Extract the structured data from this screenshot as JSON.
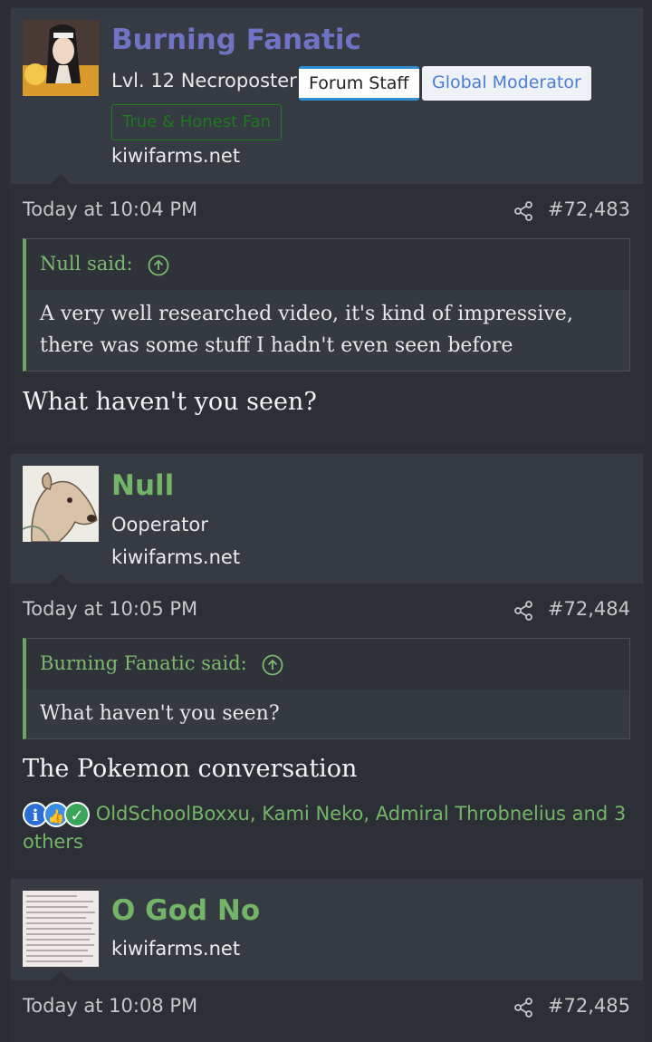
{
  "posts": [
    {
      "username": "Burning Fanatic",
      "username_color": "#7072c4",
      "title": "Lvl. 12 Necroposter",
      "badges": [
        "Forum Staff",
        "Global Moderator",
        "True & Honest Fan"
      ],
      "site": "kiwifarms.net",
      "timestamp": "Today at 10:04 PM",
      "post_number": "#72,483",
      "quote": {
        "author": "Null said:",
        "text": "A very well researched video, it's kind of impressive, there was some stuff I hadn't even seen before"
      },
      "message": "What haven't you seen?"
    },
    {
      "username": "Null",
      "username_color": "#73b567",
      "title": "Ooperator",
      "site": "kiwifarms.net",
      "timestamp": "Today at 10:05 PM",
      "post_number": "#72,484",
      "quote": {
        "author": "Burning Fanatic said:",
        "text": "What haven't you seen?"
      },
      "message": "The Pokemon conversation",
      "reactions": {
        "icons": [
          "informative-icon",
          "like-icon",
          "agree-icon"
        ],
        "text": "OldSchoolBoxxu, Kami Neko, Admiral Throbnelius and 3 others"
      }
    },
    {
      "username": "O God No",
      "username_color": "#73b567",
      "site": "kiwifarms.net",
      "timestamp": "Today at 10:08 PM",
      "post_number": "#72,485"
    }
  ]
}
